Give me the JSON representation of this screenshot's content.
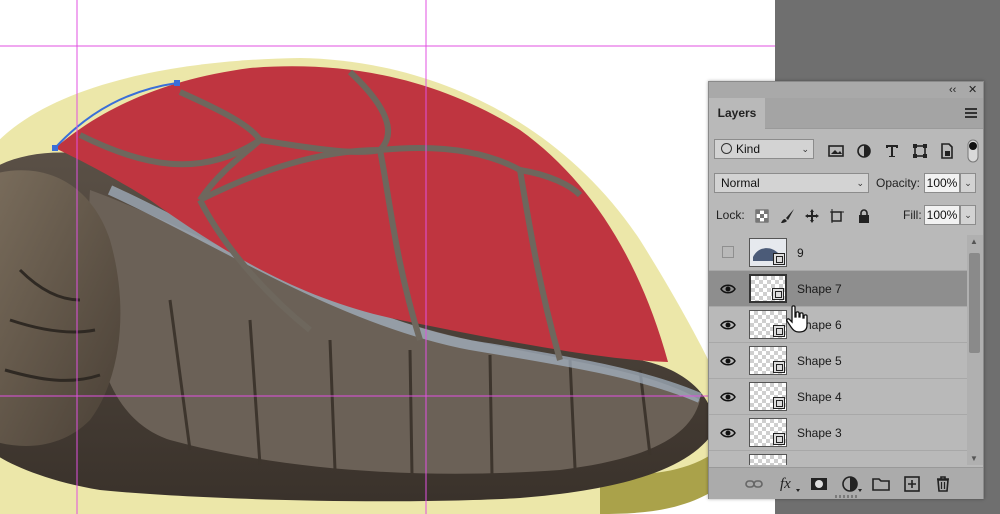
{
  "panel": {
    "collapse_glyph": "‹‹",
    "close_glyph": "✕",
    "tab_label": "Layers",
    "filter_kind": "Kind",
    "blend_mode": "Normal",
    "opacity_label": "Opacity:",
    "opacity_value": "100%",
    "lock_label": "Lock:",
    "fill_label": "Fill:",
    "fill_value": "100%"
  },
  "layers": [
    {
      "name": "9",
      "visible": false,
      "selected": false,
      "type": "smart-object"
    },
    {
      "name": "Shape 7",
      "visible": true,
      "selected": true,
      "type": "shape"
    },
    {
      "name": "Shape 6",
      "visible": true,
      "selected": false,
      "type": "shape"
    },
    {
      "name": "Shape 5",
      "visible": true,
      "selected": false,
      "type": "shape"
    },
    {
      "name": "Shape 4",
      "visible": true,
      "selected": false,
      "type": "shape"
    },
    {
      "name": "Shape 3",
      "visible": true,
      "selected": false,
      "type": "shape"
    }
  ],
  "icons": {
    "filter": [
      "image-filter-icon",
      "adjustment-filter-icon",
      "type-filter-icon",
      "shape-filter-icon",
      "smart-object-filter-icon",
      "filter-toggle-icon"
    ],
    "lock": [
      "lock-transparent-pixels-icon",
      "lock-image-pixels-icon",
      "lock-position-icon",
      "lock-artboard-icon",
      "lock-all-icon"
    ],
    "bottom": [
      "link-layers-icon",
      "fx-icon",
      "add-mask-icon",
      "adjustment-layer-icon",
      "new-group-icon",
      "new-layer-icon",
      "delete-layer-icon"
    ]
  },
  "colors": {
    "shell_fill": "#bf3540",
    "panel_bg": "#b9b9b9",
    "selected_row": "#8e8e8e",
    "guide": "#e050e0",
    "pasteboard": "#6f6f6f"
  }
}
